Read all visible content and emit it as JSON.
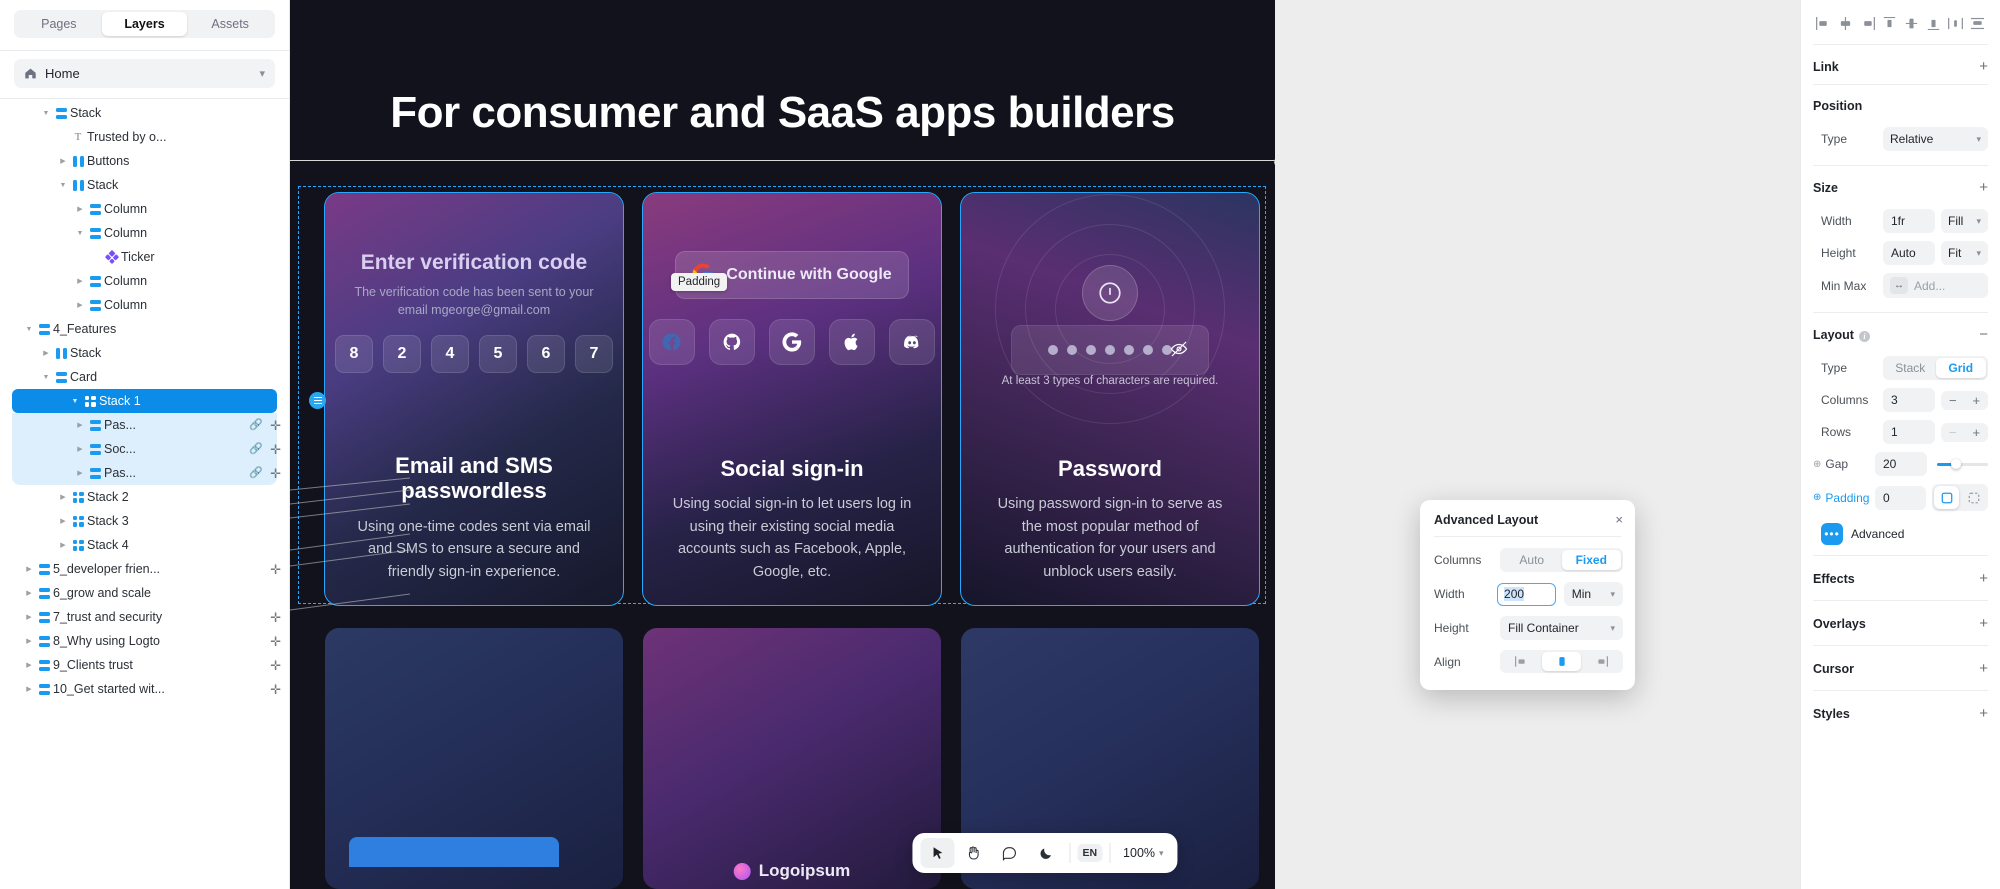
{
  "sidebar": {
    "tabs": [
      {
        "label": "Pages",
        "active": false
      },
      {
        "label": "Layers",
        "active": true
      },
      {
        "label": "Assets",
        "active": false
      }
    ],
    "home": {
      "label": "Home",
      "icon": "home-icon",
      "chevron": "chevron-down-icon"
    },
    "layers": [
      {
        "label": "Stack",
        "icon": "stack-row-icon",
        "depth": 2,
        "arrow": "down",
        "selected": false,
        "childSel": false,
        "link": false,
        "plus": false
      },
      {
        "label": "Trusted by o...",
        "icon": "text-icon",
        "depth": 3,
        "arrow": "none",
        "selected": false,
        "childSel": false,
        "link": false,
        "plus": false
      },
      {
        "label": "Buttons",
        "icon": "stack-col-icon",
        "depth": 3,
        "arrow": "right",
        "selected": false,
        "childSel": false,
        "link": false,
        "plus": false
      },
      {
        "label": "Stack",
        "icon": "stack-col-icon",
        "depth": 3,
        "arrow": "down",
        "selected": false,
        "childSel": false,
        "link": false,
        "plus": false
      },
      {
        "label": "Column",
        "icon": "stack-row-icon",
        "depth": 4,
        "arrow": "right",
        "selected": false,
        "childSel": false,
        "link": false,
        "plus": false
      },
      {
        "label": "Column",
        "icon": "stack-row-icon",
        "depth": 4,
        "arrow": "down",
        "selected": false,
        "childSel": false,
        "link": false,
        "plus": false
      },
      {
        "label": "Ticker",
        "icon": "component-icon",
        "depth": 5,
        "arrow": "none",
        "selected": false,
        "childSel": false,
        "link": false,
        "plus": false
      },
      {
        "label": "Column",
        "icon": "stack-row-icon",
        "depth": 4,
        "arrow": "right",
        "selected": false,
        "childSel": false,
        "link": false,
        "plus": false
      },
      {
        "label": "Column",
        "icon": "stack-row-icon",
        "depth": 4,
        "arrow": "right",
        "selected": false,
        "childSel": false,
        "link": false,
        "plus": false
      },
      {
        "label": "4_Features",
        "icon": "stack-row-icon",
        "depth": 1,
        "arrow": "down",
        "selected": false,
        "childSel": false,
        "link": false,
        "plus": false
      },
      {
        "label": "Stack",
        "icon": "stack-col-icon",
        "depth": 2,
        "arrow": "right",
        "selected": false,
        "childSel": false,
        "link": false,
        "plus": false
      },
      {
        "label": "Card",
        "icon": "stack-row-icon",
        "depth": 2,
        "arrow": "down",
        "selected": false,
        "childSel": false,
        "link": false,
        "plus": false
      },
      {
        "label": "Stack 1",
        "icon": "grid-icon",
        "depth": 3,
        "arrow": "down",
        "selected": true,
        "childSel": false,
        "link": false,
        "plus": false
      },
      {
        "label": "Pas...",
        "icon": "stack-row-icon",
        "depth": 4,
        "arrow": "right",
        "selected": false,
        "childSel": true,
        "link": true,
        "plus": true
      },
      {
        "label": "Soc...",
        "icon": "stack-row-icon",
        "depth": 4,
        "arrow": "right",
        "selected": false,
        "childSel": true,
        "link": true,
        "plus": true
      },
      {
        "label": "Pas...",
        "icon": "stack-row-icon",
        "depth": 4,
        "arrow": "right",
        "selected": false,
        "childSel": true,
        "link": true,
        "plus": true
      },
      {
        "label": "Stack 2",
        "icon": "grid-icon",
        "depth": 3,
        "arrow": "right",
        "selected": false,
        "childSel": false,
        "link": false,
        "plus": false
      },
      {
        "label": "Stack 3",
        "icon": "grid-icon",
        "depth": 3,
        "arrow": "right",
        "selected": false,
        "childSel": false,
        "link": false,
        "plus": false
      },
      {
        "label": "Stack 4",
        "icon": "grid-icon",
        "depth": 3,
        "arrow": "right",
        "selected": false,
        "childSel": false,
        "link": false,
        "plus": false
      },
      {
        "label": "5_developer frien...",
        "icon": "stack-row-icon",
        "depth": 1,
        "arrow": "right",
        "selected": false,
        "childSel": false,
        "link": false,
        "plus": true
      },
      {
        "label": "6_grow and scale",
        "icon": "stack-row-icon",
        "depth": 1,
        "arrow": "right",
        "selected": false,
        "childSel": false,
        "link": false,
        "plus": false
      },
      {
        "label": "7_trust and security",
        "icon": "stack-row-icon",
        "depth": 1,
        "arrow": "right",
        "selected": false,
        "childSel": false,
        "link": false,
        "plus": true
      },
      {
        "label": "8_Why using Logto",
        "icon": "stack-row-icon",
        "depth": 1,
        "arrow": "right",
        "selected": false,
        "childSel": false,
        "link": false,
        "plus": true
      },
      {
        "label": "9_Clients trust",
        "icon": "stack-row-icon",
        "depth": 1,
        "arrow": "right",
        "selected": false,
        "childSel": false,
        "link": false,
        "plus": true
      },
      {
        "label": "10_Get started wit...",
        "icon": "stack-row-icon",
        "depth": 1,
        "arrow": "right",
        "selected": false,
        "childSel": false,
        "link": false,
        "plus": true
      }
    ]
  },
  "canvas": {
    "hero_title": "For consumer and SaaS apps builders",
    "padding_tooltip": "Padding",
    "cards": [
      {
        "mock_title": "Enter verification code",
        "mock_sub": "The verification code has been sent to your email mgeorge@gmail.com",
        "code_digits": [
          "8",
          "2",
          "4",
          "5",
          "6",
          "7"
        ],
        "heading": "Email and SMS passwordless",
        "body": "Using one-time codes sent via email and SMS to ensure a secure and friendly sign-in experience."
      },
      {
        "google_button": "Continue with Google",
        "social_icons": [
          "facebook-icon",
          "github-icon",
          "google-icon",
          "apple-icon",
          "discord-icon"
        ],
        "heading": "Social sign-in",
        "body": "Using social sign-in to let users log in using their existing social media accounts such as Facebook, Apple, Google, etc."
      },
      {
        "password_hint": "At least 3 types of characters are required.",
        "heading": "Password",
        "body": "Using password sign-in to serve as the most popular method of authentication for your users and unblock users easily."
      }
    ],
    "logo_text": "Logoipsum"
  },
  "toolbar": {
    "tools": [
      {
        "name": "cursor-tool",
        "glyph": "➤",
        "active": true
      },
      {
        "name": "hand-tool",
        "glyph": "✋",
        "active": false
      },
      {
        "name": "comment-tool",
        "glyph": "὞a",
        "active": false
      },
      {
        "name": "dark-mode-tool",
        "glyph": "☾",
        "active": false
      }
    ],
    "language": "EN",
    "zoom": "100%",
    "zoom_chevron": "chevron-down-icon"
  },
  "popover": {
    "title": "Advanced Layout",
    "close": "×",
    "columns_label": "Columns",
    "columns_options": [
      "Auto",
      "Fixed"
    ],
    "columns_value": "Fixed",
    "width_label": "Width",
    "width_value": "200",
    "width_unit": "Min",
    "height_label": "Height",
    "height_value": "Fill Container",
    "align_label": "Align",
    "align_options": [
      "align-left-icon",
      "align-center-icon",
      "align-right-icon"
    ],
    "align_value": "align-center-icon"
  },
  "rightPanel": {
    "align_icons": [
      "align-horizontal-left-icon",
      "align-horizontal-center-icon",
      "align-horizontal-right-icon",
      "align-vertical-top-icon",
      "align-vertical-middle-icon",
      "align-vertical-bottom-icon",
      "distribute-horizontal-icon",
      "distribute-vertical-icon"
    ],
    "link": {
      "title": "Link",
      "action": "+"
    },
    "position": {
      "title": "Position",
      "type_label": "Type",
      "type_value": "Relative"
    },
    "size": {
      "title": "Size",
      "action": "+",
      "width_label": "Width",
      "width_value": "1fr",
      "width_mode": "Fill",
      "height_label": "Height",
      "height_value": "Auto",
      "height_mode": "Fit",
      "minmax_label": "Min Max",
      "minmax_placeholder": "Add..."
    },
    "layout": {
      "title": "Layout",
      "action": "−",
      "type_label": "Type",
      "type_options": [
        "Stack",
        "Grid"
      ],
      "type_value": "Grid",
      "columns_label": "Columns",
      "columns_value": "3",
      "rows_label": "Rows",
      "rows_value": "1",
      "gap_label": "Gap",
      "gap_value": "20",
      "padding_label": "Padding",
      "padding_value": "0",
      "advanced_label": "Advanced"
    },
    "collapsed": [
      {
        "title": "Effects",
        "action": "+"
      },
      {
        "title": "Overlays",
        "action": "+"
      },
      {
        "title": "Cursor",
        "action": "+"
      },
      {
        "title": "Styles",
        "action": "+"
      }
    ]
  }
}
